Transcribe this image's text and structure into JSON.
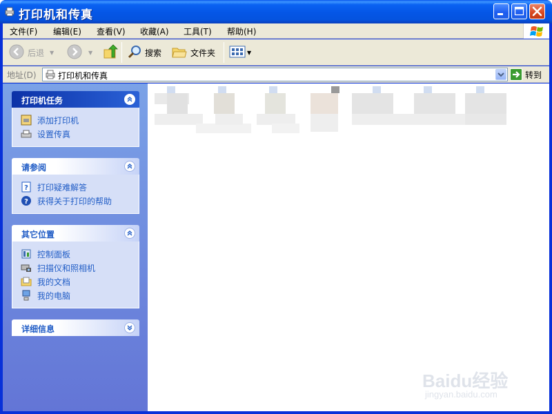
{
  "window": {
    "title": "打印机和传真"
  },
  "menu": [
    "文件(F)",
    "编辑(E)",
    "查看(V)",
    "收藏(A)",
    "工具(T)",
    "帮助(H)"
  ],
  "toolbar": {
    "back": "后退",
    "search": "搜索",
    "folders": "文件夹"
  },
  "address": {
    "label": "地址(D)",
    "value": "打印机和传真",
    "go": "转到"
  },
  "panels": [
    {
      "title": "打印机任务",
      "items": [
        "添加打印机",
        "设置传真"
      ]
    },
    {
      "title": "请参阅",
      "items": [
        "打印疑难解答",
        "获得关于打印的帮助"
      ]
    },
    {
      "title": "其它位置",
      "items": [
        "控制面板",
        "扫描仪和照相机",
        "我的文档",
        "我的电脑"
      ]
    },
    {
      "title": "详细信息",
      "items": []
    }
  ],
  "watermark": {
    "brand": "Baidu经验",
    "url": "jingyan.baidu.com"
  }
}
